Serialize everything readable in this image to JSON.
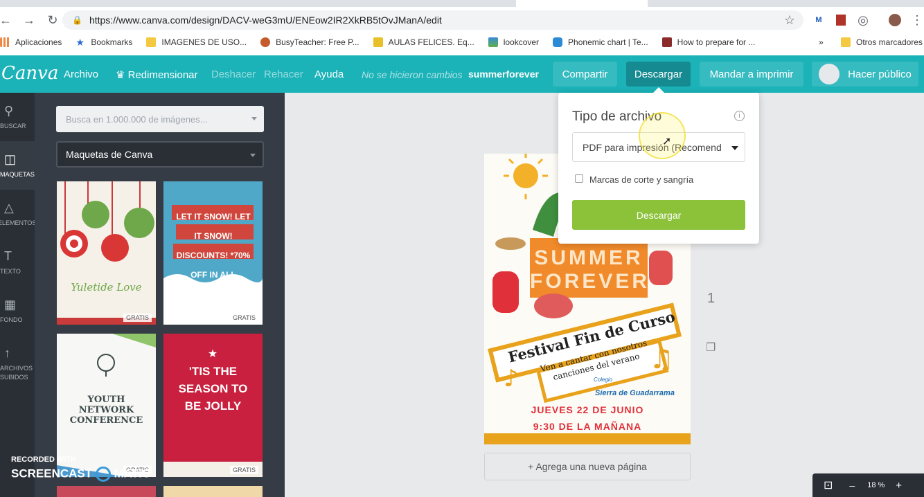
{
  "browser": {
    "url": "https://www.canva.com/design/DACV-weG3mU/ENEow2IR2XkRB5tOvJManA/edit",
    "bookmarks": [
      "Aplicaciones",
      "Bookmarks",
      "IMAGENES DE USO...",
      "BusyTeacher: Free P...",
      "AULAS FELICES. Eq...",
      "lookcover",
      "Phonemic chart | Te...",
      "How to prepare for ..."
    ],
    "other_bookmarks": "Otros marcadores",
    "overflow": "»"
  },
  "topbar": {
    "logo": "Canva",
    "menu": [
      "Archivo",
      "Redimensionar",
      "Deshacer",
      "Rehacer",
      "Ayuda"
    ],
    "status": "No se hicieron cambios",
    "design_name": "summerforever",
    "share": "Compartir",
    "download": "Descargar",
    "print": "Mandar a imprimir",
    "publish": "Hacer público"
  },
  "rail": [
    {
      "label": "BUSCAR",
      "icon": "search-icon"
    },
    {
      "label": "MAQUETAS",
      "icon": "layout-icon"
    },
    {
      "label": "ELEMENTOS",
      "icon": "shapes-icon"
    },
    {
      "label": "TEXTO",
      "icon": "text-icon"
    },
    {
      "label": "FONDO",
      "icon": "background-icon"
    },
    {
      "label": "ARCHIVOS\nSUBIDOS",
      "icon": "upload-icon"
    }
  ],
  "panel": {
    "search_placeholder": "Busca en 1.000.000 de imágenes...",
    "layouts_select": "Maquetas de Canva",
    "templates": [
      {
        "text": "Yuletide Love",
        "badge": "GRATIS"
      },
      {
        "text": "LET IT SNOW! LET IT SNOW! DISCOUNTS! *70% OFF IN ALL STORES!",
        "badge": "GRATIS"
      },
      {
        "text": "YOUTH NETWORK CONFERENCE",
        "badge": "GRATIS"
      },
      {
        "text": "'TIS THE SEASON TO BE JOLLY",
        "badge": "GRATIS"
      }
    ]
  },
  "design": {
    "title1": "SUMMER",
    "title2": "FOREVER",
    "banner": "Festival Fin de Curso",
    "sub1": "Ven a cantar con nosotros",
    "sub2": "canciones del verano",
    "school_small": "Colegio",
    "school": "Sierra de Guadarrama",
    "date": "JUEVES 22 DE JUNIO",
    "time": "9:30 DE LA MAÑANA"
  },
  "canvas": {
    "add_page": "+ Agrega una nueva página",
    "page_number": "1",
    "zoom": "18 %",
    "zoom_minus": "–",
    "zoom_plus": "+"
  },
  "popup": {
    "title": "Tipo de archivo",
    "file_type": "PDF para impresión (Recomend",
    "crop_marks": "Marcas de corte y sangría",
    "download_button": "Descargar"
  },
  "watermark": {
    "line1": "RECORDED WITH",
    "line2": "SCREENCAST",
    "line3": "MATIC"
  }
}
